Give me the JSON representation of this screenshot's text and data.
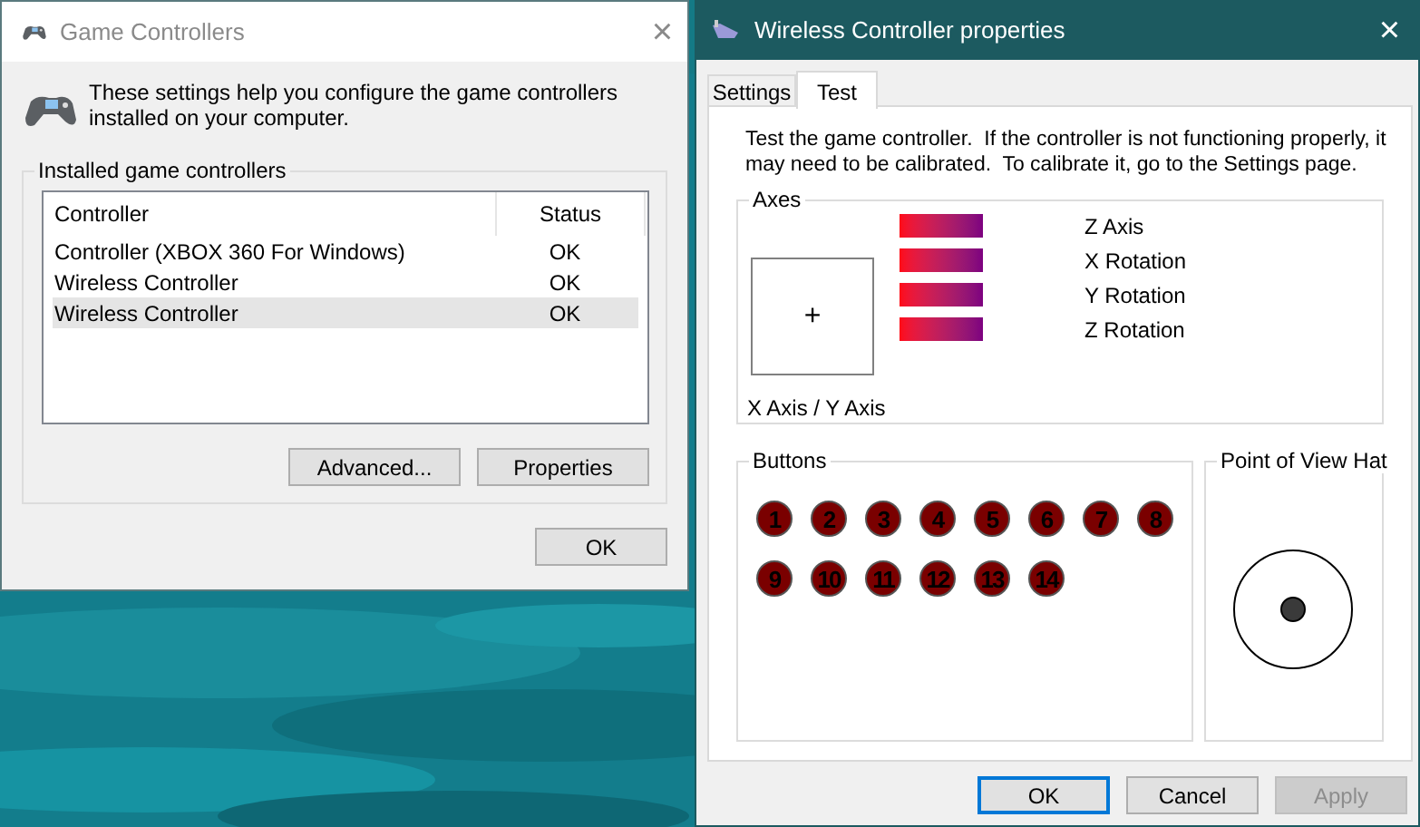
{
  "controllers_window": {
    "title": "Game Controllers",
    "close": "×",
    "intro": "These settings help you configure the game controllers installed on your computer.",
    "group_label": "Installed game controllers",
    "columns": [
      "Controller",
      "Status"
    ],
    "rows": [
      {
        "controller": "Controller (XBOX 360 For Windows)",
        "status": "OK",
        "selected": false
      },
      {
        "controller": "Wireless Controller",
        "status": "OK",
        "selected": false
      },
      {
        "controller": "Wireless Controller",
        "status": "OK",
        "selected": true
      }
    ],
    "buttons": [
      {
        "label": "Advanced...",
        "kind": "group"
      },
      {
        "label": "Properties",
        "kind": "group"
      },
      {
        "label": "OK",
        "kind": "footer"
      }
    ]
  },
  "properties_window": {
    "title": "Wireless Controller properties",
    "close": "×",
    "tabs": [
      {
        "label": "Settings",
        "selected": false
      },
      {
        "label": "Test",
        "selected": true
      }
    ],
    "description": "Test the game controller.  If the controller is not functioning properly, it may need to be calibrated.  To calibrate it, go to the Settings page.",
    "axes": {
      "label": "Axes",
      "crosshair": "+",
      "xy_label": "X Axis / Y Axis",
      "bars": [
        {
          "label": "Z Axis"
        },
        {
          "label": "X Rotation"
        },
        {
          "label": "Y Rotation"
        },
        {
          "label": "Z Rotation"
        }
      ]
    },
    "buttons_group": {
      "label": "Buttons",
      "buttons": [
        {
          "label": "1",
          "pressed": false
        },
        {
          "label": "2",
          "pressed": false
        },
        {
          "label": "3",
          "pressed": false
        },
        {
          "label": "4",
          "pressed": false
        },
        {
          "label": "5",
          "pressed": false
        },
        {
          "label": "6",
          "pressed": false
        },
        {
          "label": "7",
          "pressed": false
        },
        {
          "label": "8",
          "pressed": false
        },
        {
          "label": "9",
          "pressed": false
        },
        {
          "label": "10",
          "pressed": false
        },
        {
          "label": "11",
          "pressed": false
        },
        {
          "label": "12",
          "pressed": false
        },
        {
          "label": "13",
          "pressed": false
        },
        {
          "label": "14",
          "pressed": false
        }
      ]
    },
    "pov_hat": {
      "label": "Point of View Hat"
    },
    "footer_buttons": [
      {
        "label": "OK",
        "default": true,
        "disabled": false
      },
      {
        "label": "Cancel",
        "default": false,
        "disabled": false
      },
      {
        "label": "Apply",
        "default": false,
        "disabled": true
      }
    ]
  }
}
